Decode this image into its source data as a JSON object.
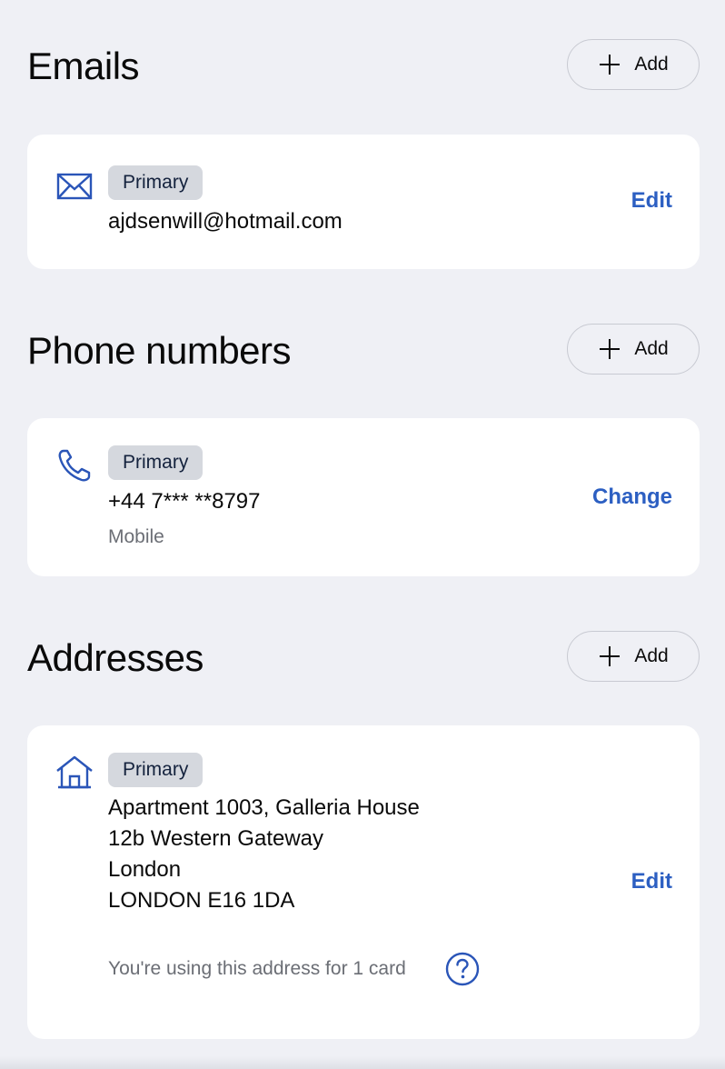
{
  "emails": {
    "title": "Emails",
    "add_label": "Add",
    "items": [
      {
        "badge": "Primary",
        "value": "ajdsenwill@hotmail.com",
        "action_label": "Edit",
        "icon": "envelope-icon"
      }
    ]
  },
  "phones": {
    "title": "Phone numbers",
    "add_label": "Add",
    "items": [
      {
        "badge": "Primary",
        "value": "+44 7*** **8797",
        "type": "Mobile",
        "action_label": "Change",
        "icon": "phone-icon"
      }
    ]
  },
  "addresses": {
    "title": "Addresses",
    "add_label": "Add",
    "items": [
      {
        "badge": "Primary",
        "lines": [
          "Apartment 1003, Galleria House",
          "12b Western Gateway",
          "London",
          "LONDON E16 1DA"
        ],
        "usage_note": "You're using this address for 1 card",
        "action_label": "Edit",
        "icon": "home-icon",
        "help_icon": "question-circle-icon"
      }
    ]
  },
  "colors": {
    "background": "#eff0f5",
    "card": "#ffffff",
    "accent": "#2c5fc2",
    "badge_bg": "#d5d8de",
    "icon": "#2a55b8"
  }
}
